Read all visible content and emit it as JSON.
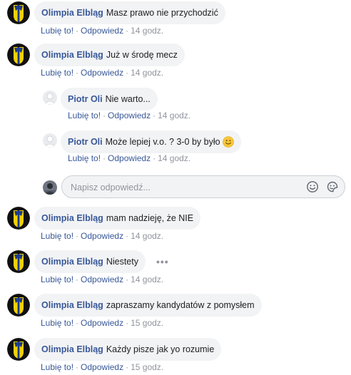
{
  "labels": {
    "like": "Lubię to!",
    "reply": "Odpowiedz",
    "dot": "·"
  },
  "colors": {
    "author": "#385898",
    "bubble": "#f2f3f5",
    "meta": "#90949c",
    "club_yellow": "#f3d200",
    "club_blue": "#1a3a8c"
  },
  "comments": [
    {
      "author": "Olimpia Elbląg",
      "text": "Masz prawo nie przychodzić",
      "time": "14 godz."
    },
    {
      "author": "Olimpia Elbląg",
      "text": "Już w środę mecz",
      "time": "14 godz."
    },
    {
      "author": "Olimpia Elbląg",
      "text": "mam nadzieję, że NIE",
      "time": "14 godz."
    },
    {
      "author": "Olimpia Elbląg",
      "text": "Niestety",
      "time": "14 godz."
    },
    {
      "author": "Olimpia Elbląg",
      "text": "zapraszamy kandydatów z pomysłem",
      "time": "15 godz."
    },
    {
      "author": "Olimpia Elbląg",
      "text": "Każdy pisze jak yo rozumie",
      "time": "15 godz."
    }
  ],
  "replies": [
    {
      "author": "Piotr Oli",
      "text": "Nie warto...",
      "time": "14 godz."
    },
    {
      "author": "Piotr Oli",
      "text": "Może lepiej v.o. ? 3-0 by było",
      "time": "14 godz.",
      "icon": "smiley-emoji-icon"
    }
  ],
  "reply_box": {
    "placeholder": "Napisz odpowiedź...",
    "icons": [
      "emoji-icon",
      "sticker-icon"
    ]
  },
  "more_options_glyph": "•••"
}
